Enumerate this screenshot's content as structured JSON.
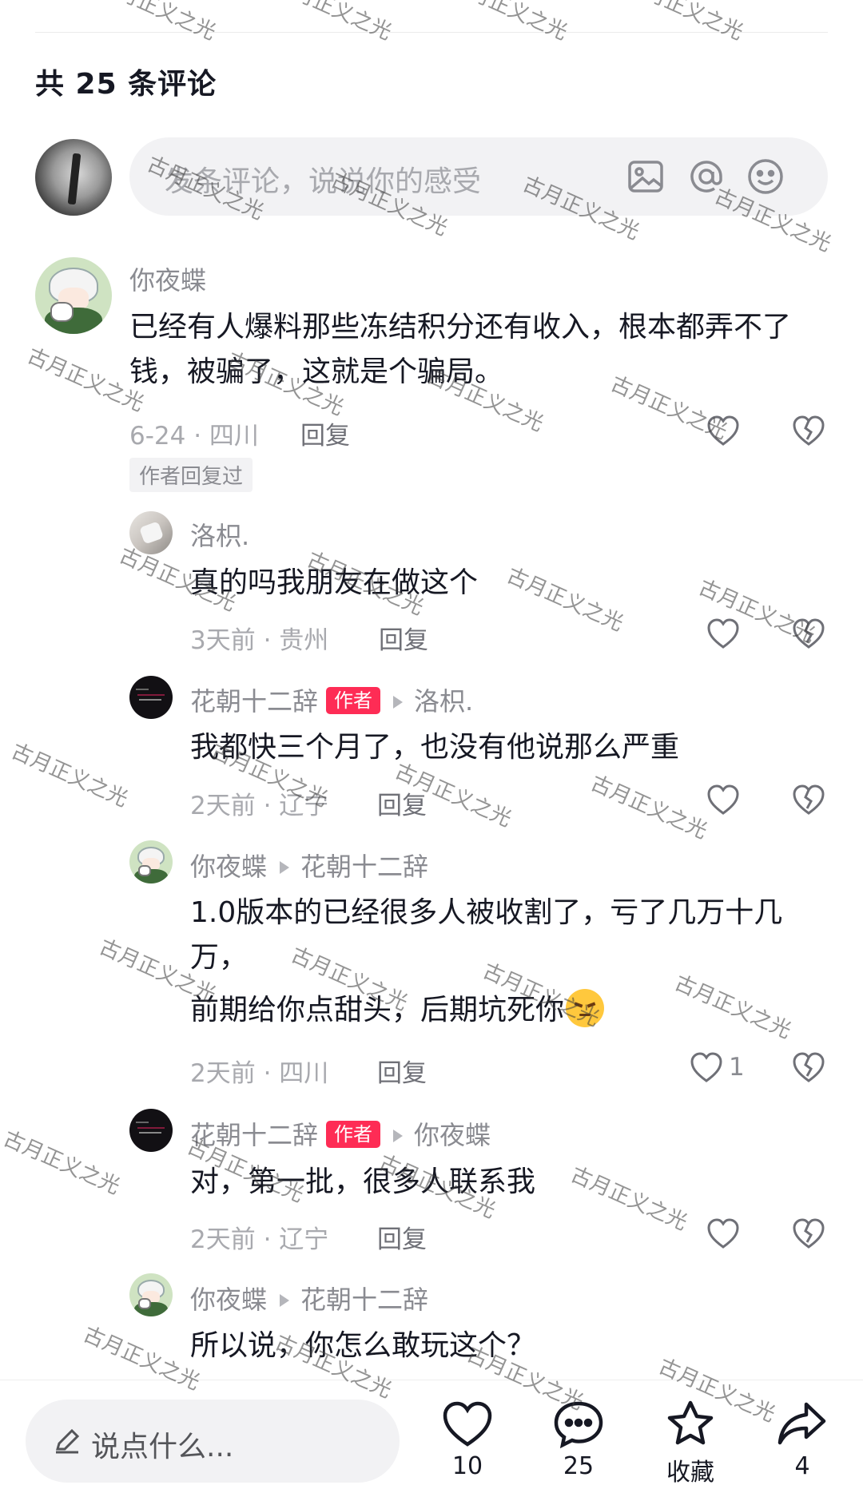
{
  "header": {
    "title": "共 25 条评论"
  },
  "input": {
    "placeholder": "发条评论，说说你的感受"
  },
  "comments": [
    {
      "user": "你夜蝶",
      "text": "已经有人爆料那些冻结积分还有收入，根本都弄不了钱，被骗了，这就是个骗局。",
      "meta": "6-24 · 四川",
      "reply": "回复",
      "tag": "作者回复过"
    }
  ],
  "replies": [
    {
      "user": "洛枳.",
      "text": "真的吗我朋友在做这个",
      "meta": "3天前 · 贵州",
      "reply": "回复"
    },
    {
      "user": "花朝十二辞",
      "badge": "作者",
      "to": "洛枳.",
      "text": "我都快三个月了，也没有他说那么严重",
      "meta": "2天前 · 辽宁",
      "reply": "回复"
    },
    {
      "user": "你夜蝶",
      "to": "花朝十二辞",
      "text_line1": "1.0版本的已经很多人被收割了，亏了几万十几",
      "text_line2": "万，",
      "text_line3": "前期给你点甜头，后期坑死你",
      "meta": "2天前 · 四川",
      "reply": "回复",
      "likes": "1"
    },
    {
      "user": "花朝十二辞",
      "badge": "作者",
      "to": "你夜蝶",
      "text": "对，第一批，很多人联系我",
      "meta": "2天前 · 辽宁",
      "reply": "回复"
    },
    {
      "user": "你夜蝶",
      "to": "花朝十二辞",
      "text": "所以说，你怎么敢玩这个？"
    }
  ],
  "bottom": {
    "placeholder": "说点什么...",
    "like_count": "10",
    "comment_count": "25",
    "favorite_label": "收藏",
    "share_count": "4"
  },
  "watermark": "古月正义之光",
  "colors": {
    "accent": "#fe2c55",
    "text": "#161823",
    "muted": "#a8a9ae"
  }
}
